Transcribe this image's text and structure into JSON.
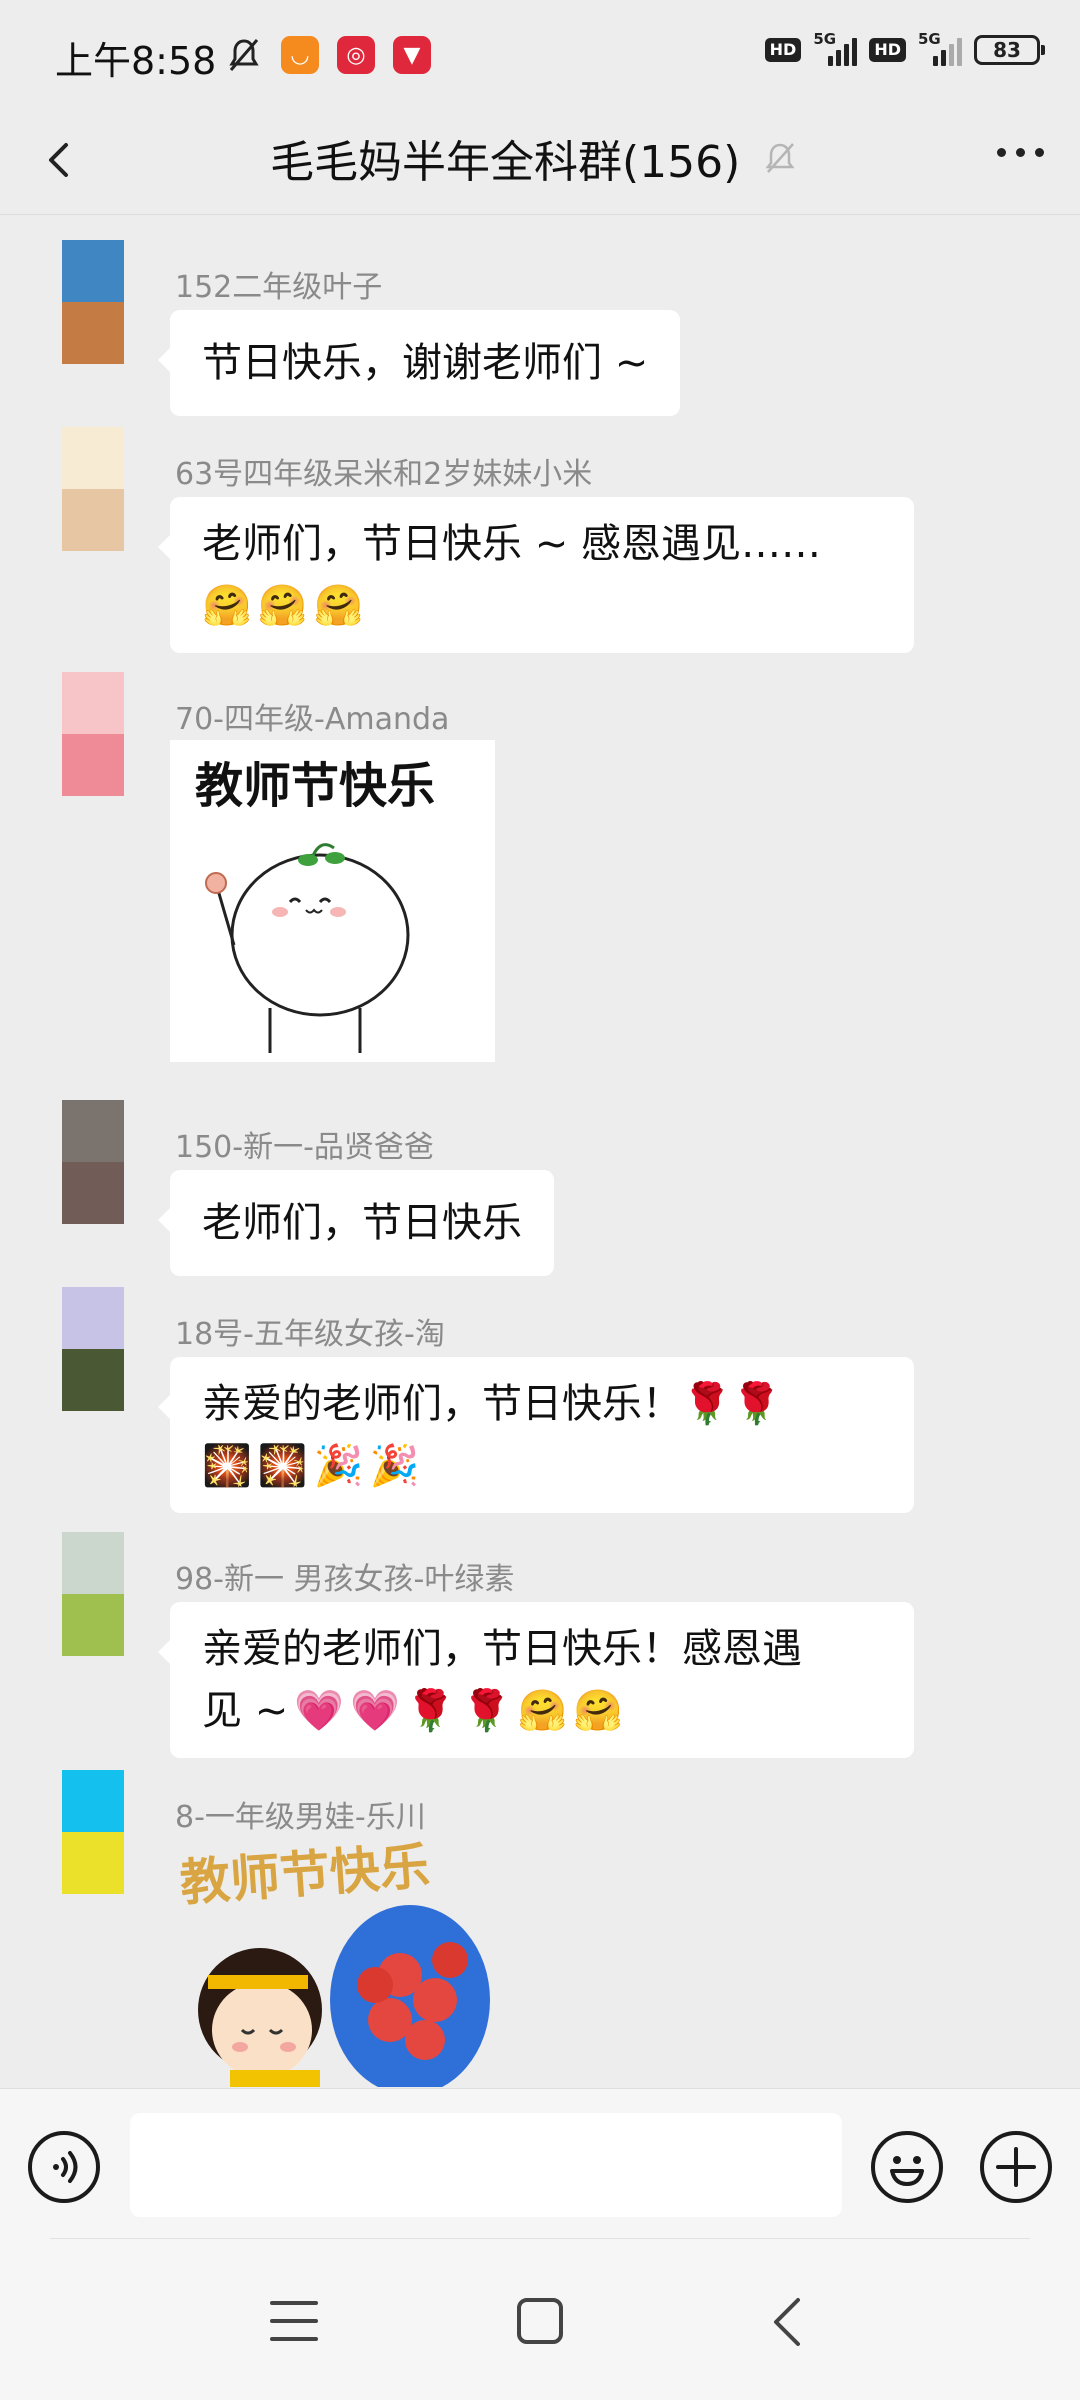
{
  "status_bar": {
    "time": "上午8:58",
    "icons": [
      "bell-muted-icon",
      "app-icon-orange",
      "app-icon-target",
      "app-icon-red"
    ],
    "signal_1": {
      "hd": "HD",
      "net": "5G"
    },
    "signal_2": {
      "hd": "HD",
      "net": "5G"
    },
    "battery": "83"
  },
  "header": {
    "title": "毛毛妈半年全科群(156)",
    "back_icon": "chevron-left-icon",
    "mute_icon": "bell-muted-icon",
    "more_icon": "more-dots-icon"
  },
  "messages": [
    {
      "sender": "152二年级叶子",
      "text": "节日快乐，谢谢老师们 ~",
      "avatar_colors": [
        "#3f86c2",
        "#c47c44"
      ]
    },
    {
      "sender": "63号四年级呆米和2岁妹妹小米",
      "text": "老师们，节日快乐 ~ 感恩遇见……",
      "emojis": [
        "🤗",
        "🤗",
        "🤗"
      ],
      "avatar_colors": [
        "#f7ecd3",
        "#e7c6a3"
      ]
    },
    {
      "sender": "70-四年级-Amanda",
      "sticker_text": "教师节快乐",
      "avatar_colors": [
        "#f7c4c7",
        "#ef8b96"
      ]
    },
    {
      "sender": "150-新一-品贤爸爸",
      "text": "老师们，节日快乐",
      "avatar_colors": [
        "#7b736d",
        "#725c57"
      ]
    },
    {
      "sender": "18号-五年级女孩-淘",
      "text": "亲爱的老师们，节日快乐！🌹🌹",
      "emojis": [
        "🎇",
        "🎇",
        "🎉",
        "🎉"
      ],
      "avatar_colors": [
        "#c6c3e6",
        "#4a5934"
      ]
    },
    {
      "sender": "98-新一 男孩女孩-叶绿素",
      "text": "亲爱的老师们，节日快乐！感恩遇",
      "text_line2": "见 ~",
      "emojis": [
        "💗",
        "💗",
        "🌹",
        "🌹",
        "🤗",
        "🤗"
      ],
      "avatar_colors": [
        "#cbd6cd",
        "#9fc04f"
      ]
    },
    {
      "sender": "8-一年级男娃-乐川",
      "sticker_text": "教师节快乐",
      "avatar_colors": [
        "#14c0ee",
        "#ebe12a"
      ]
    }
  ],
  "input_bar": {
    "placeholder": "",
    "voice_icon": "voice-icon",
    "emoji_icon": "smile-icon",
    "plus_icon": "plus-icon"
  },
  "system_nav": {
    "menu_icon": "menu-icon",
    "home_icon": "home-icon",
    "back_icon": "back-icon"
  }
}
